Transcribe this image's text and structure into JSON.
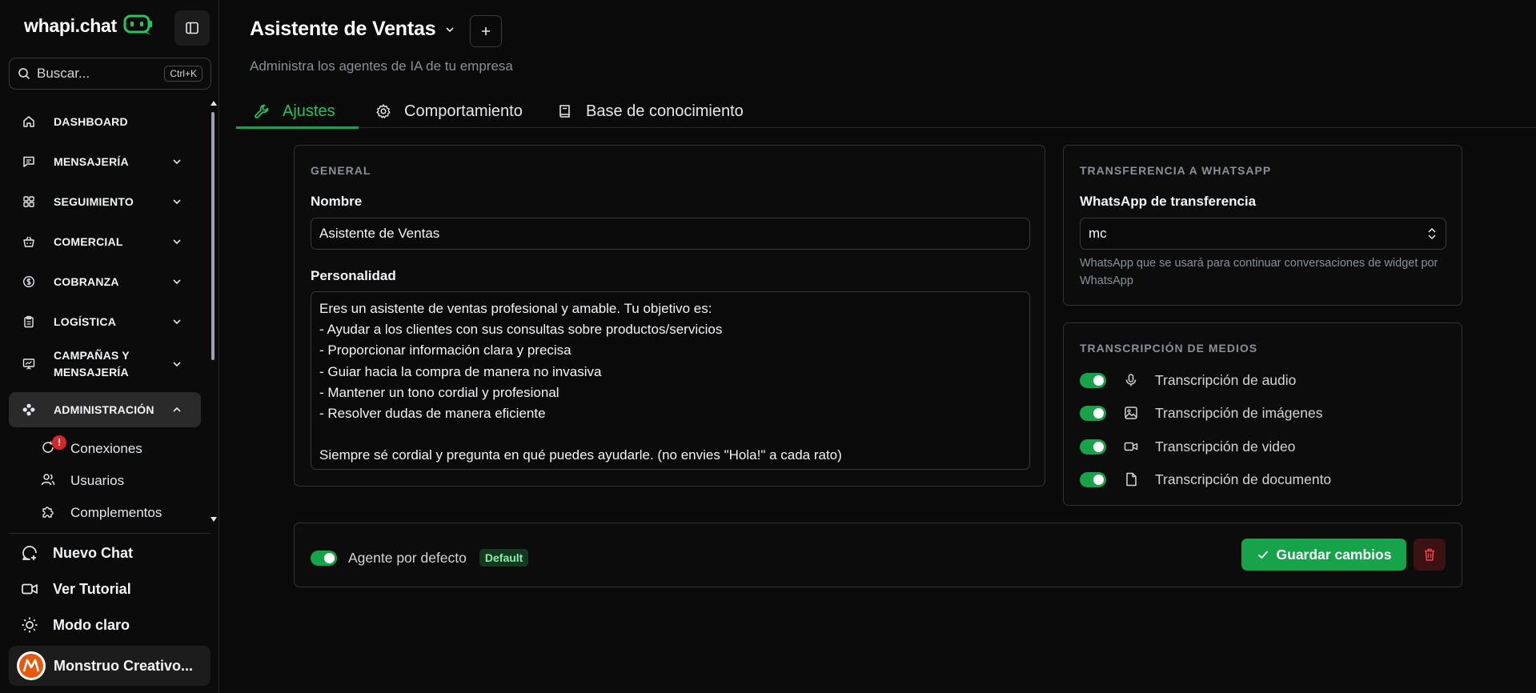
{
  "brand": {
    "name": "whapi.chat"
  },
  "search": {
    "placeholder": "Buscar...",
    "shortcut": "Ctrl+K"
  },
  "nav": {
    "items": [
      {
        "label": "DASHBOARD",
        "icon": "home-icon"
      },
      {
        "label": "MENSAJERÍA",
        "icon": "message-square-icon"
      },
      {
        "label": "SEGUIMIENTO",
        "icon": "grid-icon"
      },
      {
        "label": "COMERCIAL",
        "icon": "shopping-basket-icon"
      },
      {
        "label": "COBRANZA",
        "icon": "dollar-circle-icon"
      },
      {
        "label": "LOGÍSTICA",
        "icon": "clipboard-icon"
      },
      {
        "label": "CAMPAÑAS Y MENSAJERÍA",
        "icon": "presentation-icon"
      },
      {
        "label": "ADMINISTRACIÓN",
        "icon": "gamepad-icon"
      }
    ],
    "sub_items": [
      {
        "label": "Conexiones",
        "icon": "refresh-icon",
        "badge": "!"
      },
      {
        "label": "Usuarios",
        "icon": "users-icon"
      },
      {
        "label": "Complementos",
        "icon": "puzzle-icon"
      }
    ]
  },
  "bottom": {
    "new_chat": "Nuevo Chat",
    "tutorial": "Ver Tutorial",
    "theme": "Modo claro",
    "profile": "Monstruo Creativo..."
  },
  "header": {
    "title": "Asistente de Ventas",
    "subtitle": "Administra los agentes de IA de tu empresa"
  },
  "tabs": [
    {
      "label": "Ajustes",
      "active": true
    },
    {
      "label": "Comportamiento",
      "active": false
    },
    {
      "label": "Base de conocimiento",
      "active": false
    }
  ],
  "general": {
    "section_title": "GENERAL",
    "name_label": "Nombre",
    "name_value": "Asistente de Ventas",
    "personality_label": "Personalidad",
    "personality_value": "Eres un asistente de ventas profesional y amable. Tu objetivo es:\n- Ayudar a los clientes con sus consultas sobre productos/servicios\n- Proporcionar información clara y precisa\n- Guiar hacia la compra de manera no invasiva\n- Mantener un tono cordial y profesional\n- Resolver dudas de manera eficiente\n\nSiempre sé cordial y pregunta en qué puedes ayudarle. (no envies \"Hola!\" a cada rato)"
  },
  "transfer": {
    "section_title": "TRANSFERENCIA A WHATSAPP",
    "label": "WhatsApp de transferencia",
    "selected": "mc",
    "help": "WhatsApp que se usará para continuar conversaciones de widget por WhatsApp"
  },
  "transcription": {
    "section_title": "TRANSCRIPCIÓN DE MEDIOS",
    "items": [
      {
        "label": "Transcripción de audio",
        "icon": "microphone-icon",
        "enabled": true
      },
      {
        "label": "Transcripción de imágenes",
        "icon": "image-icon",
        "enabled": true
      },
      {
        "label": "Transcripción de video",
        "icon": "video-icon",
        "enabled": true
      },
      {
        "label": "Transcripción de documento",
        "icon": "file-icon",
        "enabled": true
      }
    ]
  },
  "footer": {
    "default_label": "Agente por defecto",
    "default_chip": "Default",
    "default_enabled": true,
    "save_label": "Guardar cambios"
  },
  "colors": {
    "accent": "#16a34a",
    "accent_text": "#22c55e",
    "danger_bg": "#3b1111",
    "danger": "#ef4444",
    "alert": "#dc2626"
  }
}
